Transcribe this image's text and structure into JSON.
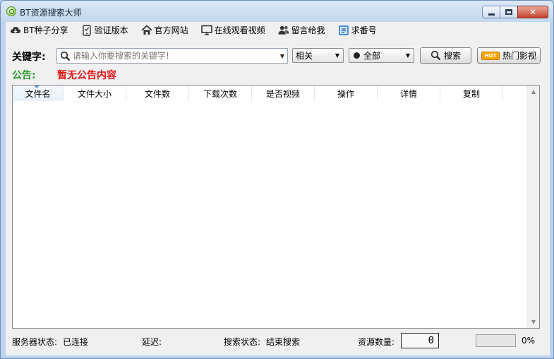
{
  "window": {
    "title": "BT资源搜索大师",
    "close_glyph": "✕"
  },
  "menu": [
    {
      "label": "BT种子分享",
      "icon": "cloud-icon"
    },
    {
      "label": "验证版本",
      "icon": "phone-icon"
    },
    {
      "label": "官方网站",
      "icon": "house-icon"
    },
    {
      "label": "在线观看视频",
      "icon": "monitor-icon"
    },
    {
      "label": "留言给我",
      "icon": "users-icon"
    },
    {
      "label": "求番号",
      "icon": "sticker-icon"
    }
  ],
  "search": {
    "label": "关键字:",
    "placeholder": "请输入你要搜索的关键字!",
    "sort_value": "相关",
    "filter_value": "全部",
    "search_button": "搜索",
    "hot_button": "热门影视",
    "hot_badge": "HOT"
  },
  "notice": {
    "label": "公告:",
    "text": "暂无公告内容"
  },
  "table": {
    "columns": [
      "文件名",
      "文件大小",
      "文件数",
      "下载次数",
      "是否视频",
      "操作",
      "详情",
      "复制",
      ""
    ],
    "rows": []
  },
  "status": {
    "server_label": "服务器状态:",
    "server_value": "已连接",
    "latency_label": "延迟:",
    "latency_value": "",
    "search_label": "搜索状态:",
    "search_value": "结束搜索",
    "count_label": "资源数量:",
    "count_value": "0",
    "progress_percent": 0,
    "progress_text": "0%"
  },
  "colors": {
    "notice_label": "#2f9a2f",
    "notice_text": "#e01010",
    "progress_fill": "#06b025"
  }
}
